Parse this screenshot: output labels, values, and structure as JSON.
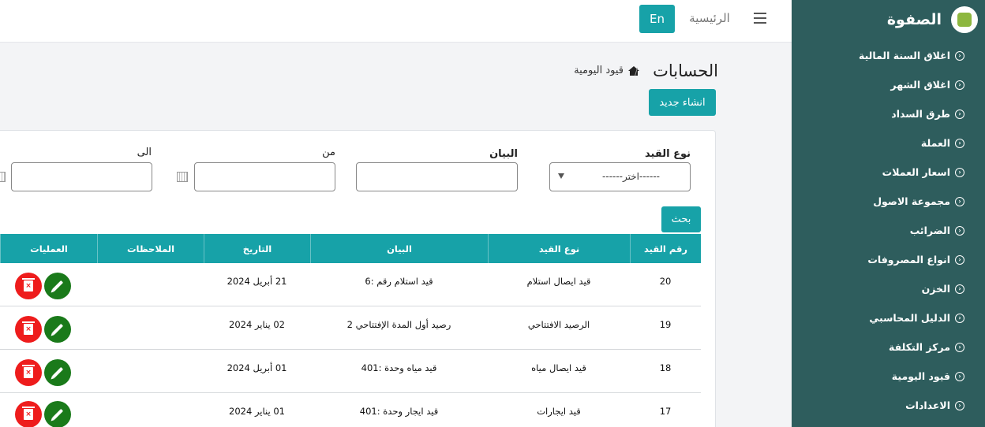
{
  "sidebar": {
    "brand": "الصفوة",
    "logo_text": "الصفوة",
    "items": [
      {
        "label": "اغلاق السنة المالية"
      },
      {
        "label": "اغلاق الشهر"
      },
      {
        "label": "طرق السداد"
      },
      {
        "label": "العملة"
      },
      {
        "label": "اسعار العملات"
      },
      {
        "label": "مجموعة الاصول"
      },
      {
        "label": "الضرائب"
      },
      {
        "label": "انواع المصروفات"
      },
      {
        "label": "الخزن"
      },
      {
        "label": "الدليل المحاسبي"
      },
      {
        "label": "مركز التكلفة"
      },
      {
        "label": "قيود اليومية"
      },
      {
        "label": "الاعدادات"
      }
    ]
  },
  "topbar": {
    "home_label": "الرئيسية",
    "lang_label": "En"
  },
  "page": {
    "title": "الحسابات",
    "breadcrumb_current": "قيود اليومية",
    "breadcrumb_sep": "/",
    "new_button": "انشاء جديد"
  },
  "filters": {
    "entry_type_label": "نوع القيد",
    "entry_type_value": "------اختر------",
    "statement_label": "البيان",
    "from_label": "من",
    "to_label": "الى",
    "search_button": "بحث"
  },
  "table": {
    "headers": {
      "entry_no": "رقم القيد",
      "entry_type": "نوع القيد",
      "statement": "البيان",
      "date": "التاريخ",
      "notes": "الملاحظات",
      "operations": "العمليات"
    },
    "rows": [
      {
        "entry_no": "20",
        "entry_type": "قيد ايصال استلام",
        "statement": "قيد استلام رقم :6",
        "date": "21 أبريل 2024",
        "notes": ""
      },
      {
        "entry_no": "19",
        "entry_type": "الرصيد الافتتاحي",
        "statement": "رصيد أول المدة الإفتتاحي 2",
        "date": "02 يناير 2024",
        "notes": ""
      },
      {
        "entry_no": "18",
        "entry_type": "قيد ايصال مياه",
        "statement": "قيد مياه وحدة :401",
        "date": "01 أبريل 2024",
        "notes": ""
      },
      {
        "entry_no": "17",
        "entry_type": "قيد ايجارات",
        "statement": "قيد ايجار وحدة :401",
        "date": "01 يناير 2024",
        "notes": ""
      }
    ]
  },
  "colors": {
    "sidebar_bg": "#2e5d5d",
    "accent": "#17a2a8",
    "edit": "#1a7a1a",
    "delete": "#ee1c1c"
  }
}
